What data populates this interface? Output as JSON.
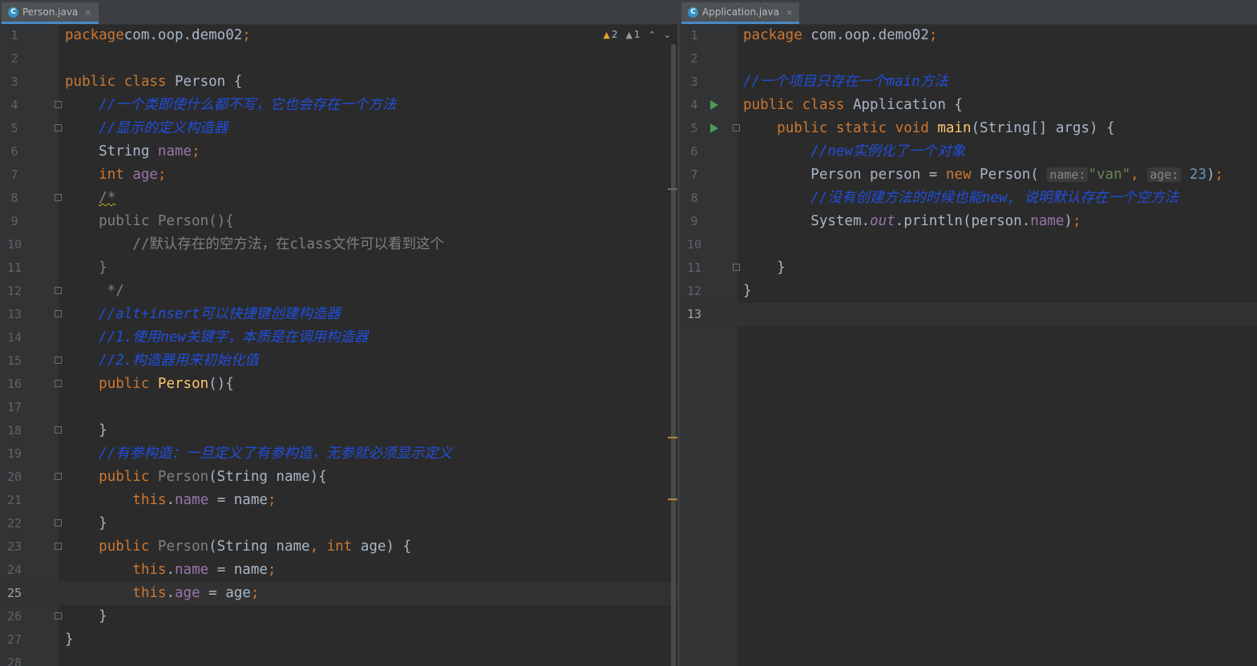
{
  "left_editor": {
    "tab": {
      "icon": "java-class-icon",
      "icon_letter": "C",
      "title": "Person.java",
      "close": "×"
    },
    "inspections": {
      "warnings": "2",
      "weak_warnings": "1",
      "prev": "⌃",
      "next": "⌄"
    },
    "lines": [
      {
        "n": "1",
        "segs": [
          [
            "kw",
            "package"
          ],
          [
            "",
            "com.oop.demo02"
          ],
          [
            "kw",
            ";"
          ]
        ]
      },
      {
        "n": "2",
        "segs": []
      },
      {
        "n": "3",
        "segs": [
          [
            "kw",
            "public class "
          ],
          [
            "",
            "Person {"
          ]
        ]
      },
      {
        "n": "4",
        "segs": [
          [
            "",
            "    "
          ],
          [
            "cm",
            "//一个类即使什么都不写，它也会存在一个方法"
          ]
        ],
        "fold": true
      },
      {
        "n": "5",
        "segs": [
          [
            "",
            "    "
          ],
          [
            "cm",
            "//显示的定义构造器"
          ]
        ],
        "fold": true
      },
      {
        "n": "6",
        "segs": [
          [
            "",
            "    String "
          ],
          [
            "fld",
            "name"
          ],
          [
            "kw",
            ";"
          ]
        ]
      },
      {
        "n": "7",
        "segs": [
          [
            "",
            "    "
          ],
          [
            "kw",
            "int "
          ],
          [
            "fld",
            "age"
          ],
          [
            "kw",
            ";"
          ]
        ]
      },
      {
        "n": "8",
        "segs": [
          [
            "",
            "    "
          ],
          [
            "gc squig",
            "/*"
          ]
        ],
        "fold": true
      },
      {
        "n": "9",
        "segs": [
          [
            "gc",
            "    public Person(){"
          ]
        ]
      },
      {
        "n": "10",
        "segs": [
          [
            "gc",
            "        //默认存在的空方法，在class文件可以看到这个"
          ]
        ]
      },
      {
        "n": "11",
        "segs": [
          [
            "gc",
            "    }"
          ]
        ]
      },
      {
        "n": "12",
        "segs": [
          [
            "gc",
            "     */"
          ]
        ],
        "fold": true
      },
      {
        "n": "13",
        "segs": [
          [
            "",
            "    "
          ],
          [
            "cm",
            "//alt+insert可以快捷键创建构造器"
          ]
        ],
        "fold": true
      },
      {
        "n": "14",
        "segs": [
          [
            "",
            "    "
          ],
          [
            "cm",
            "//1.使用new关键字，本质是在调用构造器"
          ]
        ]
      },
      {
        "n": "15",
        "segs": [
          [
            "",
            "    "
          ],
          [
            "cm",
            "//2.构造器用来初始化值"
          ]
        ],
        "fold": true
      },
      {
        "n": "16",
        "segs": [
          [
            "",
            "    "
          ],
          [
            "kw",
            "public "
          ],
          [
            "fn",
            "Person"
          ],
          [
            "",
            "(){"
          ]
        ],
        "fold": true
      },
      {
        "n": "17",
        "segs": []
      },
      {
        "n": "18",
        "segs": [
          [
            "",
            "    }"
          ]
        ],
        "fold": true
      },
      {
        "n": "19",
        "segs": [
          [
            "",
            "    "
          ],
          [
            "cm",
            "//有参构造：一旦定义了有参构造，无参就必须显示定义"
          ]
        ]
      },
      {
        "n": "20",
        "segs": [
          [
            "",
            "    "
          ],
          [
            "kw",
            "public "
          ],
          [
            "unused",
            "Person"
          ],
          [
            "",
            "(String name){"
          ]
        ],
        "fold": true
      },
      {
        "n": "21",
        "segs": [
          [
            "",
            "        "
          ],
          [
            "kw",
            "this"
          ],
          [
            "",
            "."
          ],
          [
            "fld",
            "name"
          ],
          [
            "",
            " = name"
          ],
          [
            "kw",
            ";"
          ]
        ]
      },
      {
        "n": "22",
        "segs": [
          [
            "",
            "    }"
          ]
        ],
        "fold": true
      },
      {
        "n": "23",
        "segs": [
          [
            "",
            "    "
          ],
          [
            "kw",
            "public "
          ],
          [
            "unused",
            "Person"
          ],
          [
            "",
            "(String name"
          ],
          [
            "kw",
            ", int "
          ],
          [
            "",
            "age) {"
          ]
        ],
        "fold": true
      },
      {
        "n": "24",
        "segs": [
          [
            "",
            "        "
          ],
          [
            "kw",
            "this"
          ],
          [
            "",
            "."
          ],
          [
            "fld",
            "name"
          ],
          [
            "",
            " = name"
          ],
          [
            "kw",
            ";"
          ]
        ]
      },
      {
        "n": "25",
        "segs": [
          [
            "",
            "        "
          ],
          [
            "kw",
            "this"
          ],
          [
            "",
            "."
          ],
          [
            "fld",
            "age"
          ],
          [
            "",
            " = age"
          ],
          [
            "kw",
            ";"
          ]
        ],
        "current": true
      },
      {
        "n": "26",
        "segs": [
          [
            "",
            "    }"
          ]
        ],
        "fold": true
      },
      {
        "n": "27",
        "segs": [
          [
            "",
            "}"
          ]
        ]
      },
      {
        "n": "28",
        "segs": []
      }
    ]
  },
  "right_editor": {
    "tab": {
      "icon": "java-class-icon",
      "icon_letter": "C",
      "title": "Application.java",
      "close": "×"
    },
    "lines": [
      {
        "n": "1",
        "segs": [
          [
            "kw",
            "package "
          ],
          [
            "",
            "com.oop.demo02"
          ],
          [
            "kw",
            ";"
          ]
        ]
      },
      {
        "n": "2",
        "segs": []
      },
      {
        "n": "3",
        "segs": [
          [
            "cm",
            "//一个项目只存在一个main方法"
          ]
        ]
      },
      {
        "n": "4",
        "segs": [
          [
            "kw",
            "public class "
          ],
          [
            "",
            "Application {"
          ]
        ],
        "run": true
      },
      {
        "n": "5",
        "segs": [
          [
            "",
            "    "
          ],
          [
            "kw",
            "public static void "
          ],
          [
            "fn",
            "main"
          ],
          [
            "",
            "(String[] args) {"
          ]
        ],
        "run": true,
        "fold": true
      },
      {
        "n": "6",
        "segs": [
          [
            "",
            "        "
          ],
          [
            "cm",
            "//new实例化了一个对象"
          ]
        ]
      },
      {
        "n": "7",
        "segs": [
          [
            "",
            "        Person person = "
          ],
          [
            "kw",
            "new "
          ],
          [
            "",
            "Person( "
          ],
          [
            "hint",
            "name:"
          ],
          [
            "str",
            "\"van\""
          ],
          [
            "kw",
            ", "
          ],
          [
            "hint",
            "age:"
          ],
          [
            "num",
            " 23"
          ],
          [
            "",
            ")"
          ],
          [
            "kw",
            ";"
          ]
        ]
      },
      {
        "n": "8",
        "segs": [
          [
            "",
            "        "
          ],
          [
            "cm",
            "//没有创建方法的时候也能new, 说明默认存在一个空方法"
          ]
        ]
      },
      {
        "n": "9",
        "segs": [
          [
            "",
            "        System."
          ],
          [
            "italic-fld",
            "out"
          ],
          [
            "",
            ".println(person."
          ],
          [
            "fld",
            "name"
          ],
          [
            "",
            ")"
          ],
          [
            "kw",
            ";"
          ]
        ]
      },
      {
        "n": "10",
        "segs": []
      },
      {
        "n": "11",
        "segs": [
          [
            "",
            "    }"
          ]
        ],
        "fold": true
      },
      {
        "n": "12",
        "segs": [
          [
            "",
            "}"
          ]
        ]
      },
      {
        "n": "13",
        "segs": [],
        "current": true
      }
    ]
  }
}
